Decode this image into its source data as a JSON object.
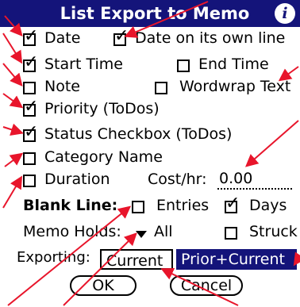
{
  "title": "List Export to Memo",
  "info_icon": "info-icon",
  "options": {
    "date": {
      "label": "Date",
      "checked": true
    },
    "date_own_line": {
      "label": "Date on its own line",
      "checked": true
    },
    "start_time": {
      "label": "Start Time",
      "checked": true
    },
    "end_time": {
      "label": "End Time",
      "checked": false
    },
    "note": {
      "label": "Note",
      "checked": false
    },
    "wordwrap": {
      "label": "Wordwrap Text",
      "checked": false
    },
    "priority": {
      "label": "Priority (ToDos)",
      "checked": true
    },
    "status": {
      "label": "Status Checkbox (ToDos)",
      "checked": true
    },
    "category": {
      "label": "Category Name",
      "checked": false
    },
    "duration": {
      "label": "Duration",
      "checked": false
    }
  },
  "cost": {
    "label": "Cost/hr:",
    "value": "0.00"
  },
  "blank_line": {
    "label": "Blank Line:",
    "entries": {
      "label": "Entries",
      "checked": false
    },
    "days": {
      "label": "Days",
      "checked": true
    }
  },
  "memo_holds": {
    "label": "Memo Holds:",
    "value": "All"
  },
  "struck": {
    "label": "Struck",
    "checked": false
  },
  "exporting": {
    "label": "Exporting:",
    "current": "Current",
    "prior_current": "Prior+Current",
    "selected": "Prior+Current"
  },
  "buttons": {
    "ok": "OK",
    "cancel": "Cancel"
  },
  "colors": {
    "title_bg": "#14147a",
    "arrow": "#e8152b"
  }
}
